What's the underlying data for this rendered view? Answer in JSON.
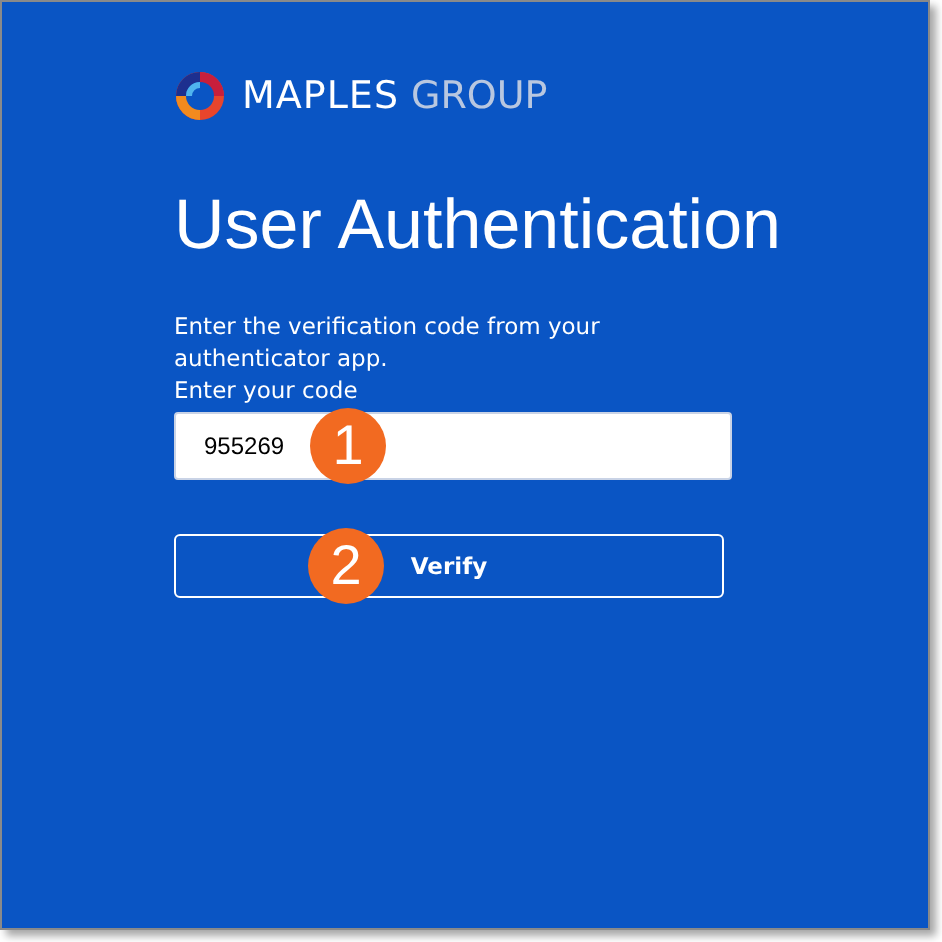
{
  "logo": {
    "brand": "MAPLES",
    "suffix": "GROUP"
  },
  "title": "User Authentication",
  "instructions": "Enter the verification code from your authenticator app.",
  "code_field": {
    "label": "Enter your code",
    "value": "955269"
  },
  "verify_button": {
    "label": "Verify"
  },
  "callouts": [
    "1",
    "2"
  ]
}
